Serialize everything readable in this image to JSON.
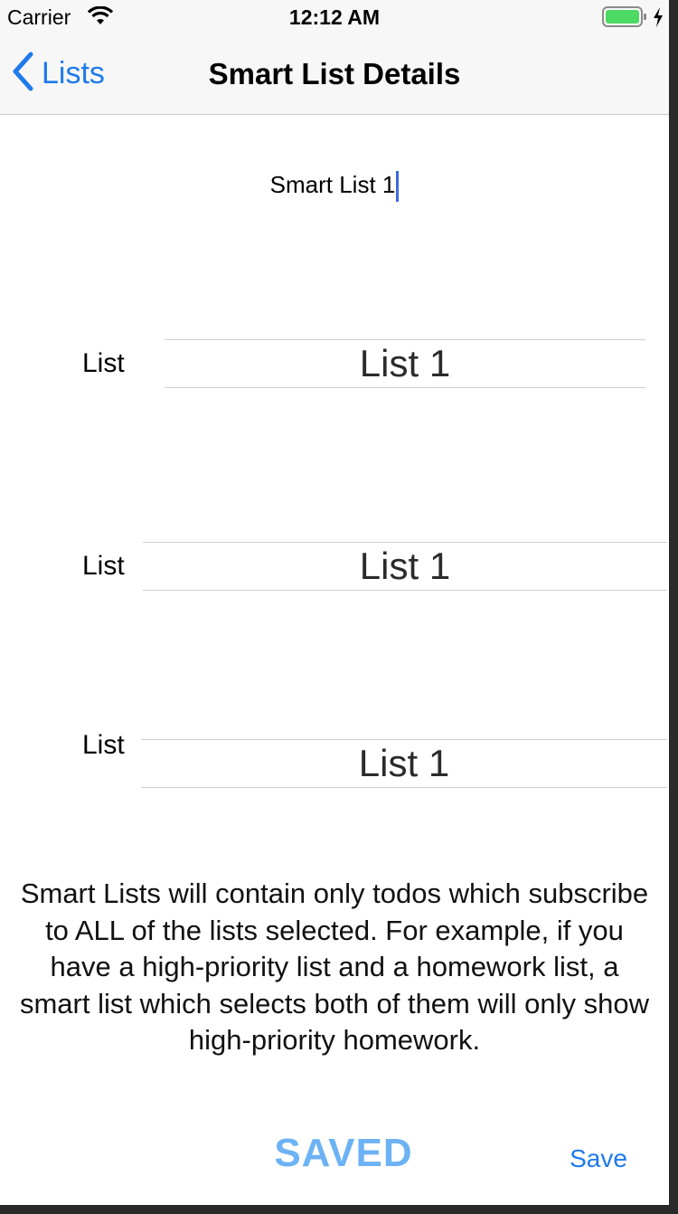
{
  "status_bar": {
    "carrier": "Carrier",
    "time": "12:12 AM",
    "wifi_icon": "wifi-icon",
    "battery_icon": "battery-charging-icon"
  },
  "nav": {
    "back_label": "Lists",
    "title": "Smart List Details",
    "accent_color": "#1f7aeb"
  },
  "smart_list_name": "Smart List 1",
  "rows": [
    {
      "label": "List",
      "selected": "List 1"
    },
    {
      "label": "List",
      "selected": "List 1"
    },
    {
      "label": "List",
      "selected": "List 1"
    }
  ],
  "info_text": "Smart Lists will contain only todos which subscribe to ALL of the lists selected. For example, if you have a high-priority list and a homework list, a smart list which selects both of them will only show high-priority homework.",
  "saved_label": "SAVED",
  "save_button_label": "Save",
  "colors": {
    "saved": "#6cb2f5",
    "caret": "#3b6be0",
    "battery": "#4cd964"
  }
}
